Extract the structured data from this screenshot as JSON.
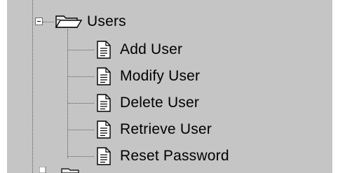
{
  "tree": {
    "root": {
      "label": "Users",
      "expanded": true,
      "icon": "open-folder-icon",
      "expander_icon": "minus-box-icon"
    },
    "children": [
      {
        "label": "Add User",
        "icon": "document-icon"
      },
      {
        "label": "Modify User",
        "icon": "document-icon"
      },
      {
        "label": "Delete User",
        "icon": "document-icon"
      },
      {
        "label": "Retrieve User",
        "icon": "document-icon"
      },
      {
        "label": "Reset Password",
        "icon": "document-icon"
      }
    ]
  },
  "colors": {
    "background": "#c5c5c5",
    "connector": "#5a5a5a",
    "text": "#000000"
  }
}
